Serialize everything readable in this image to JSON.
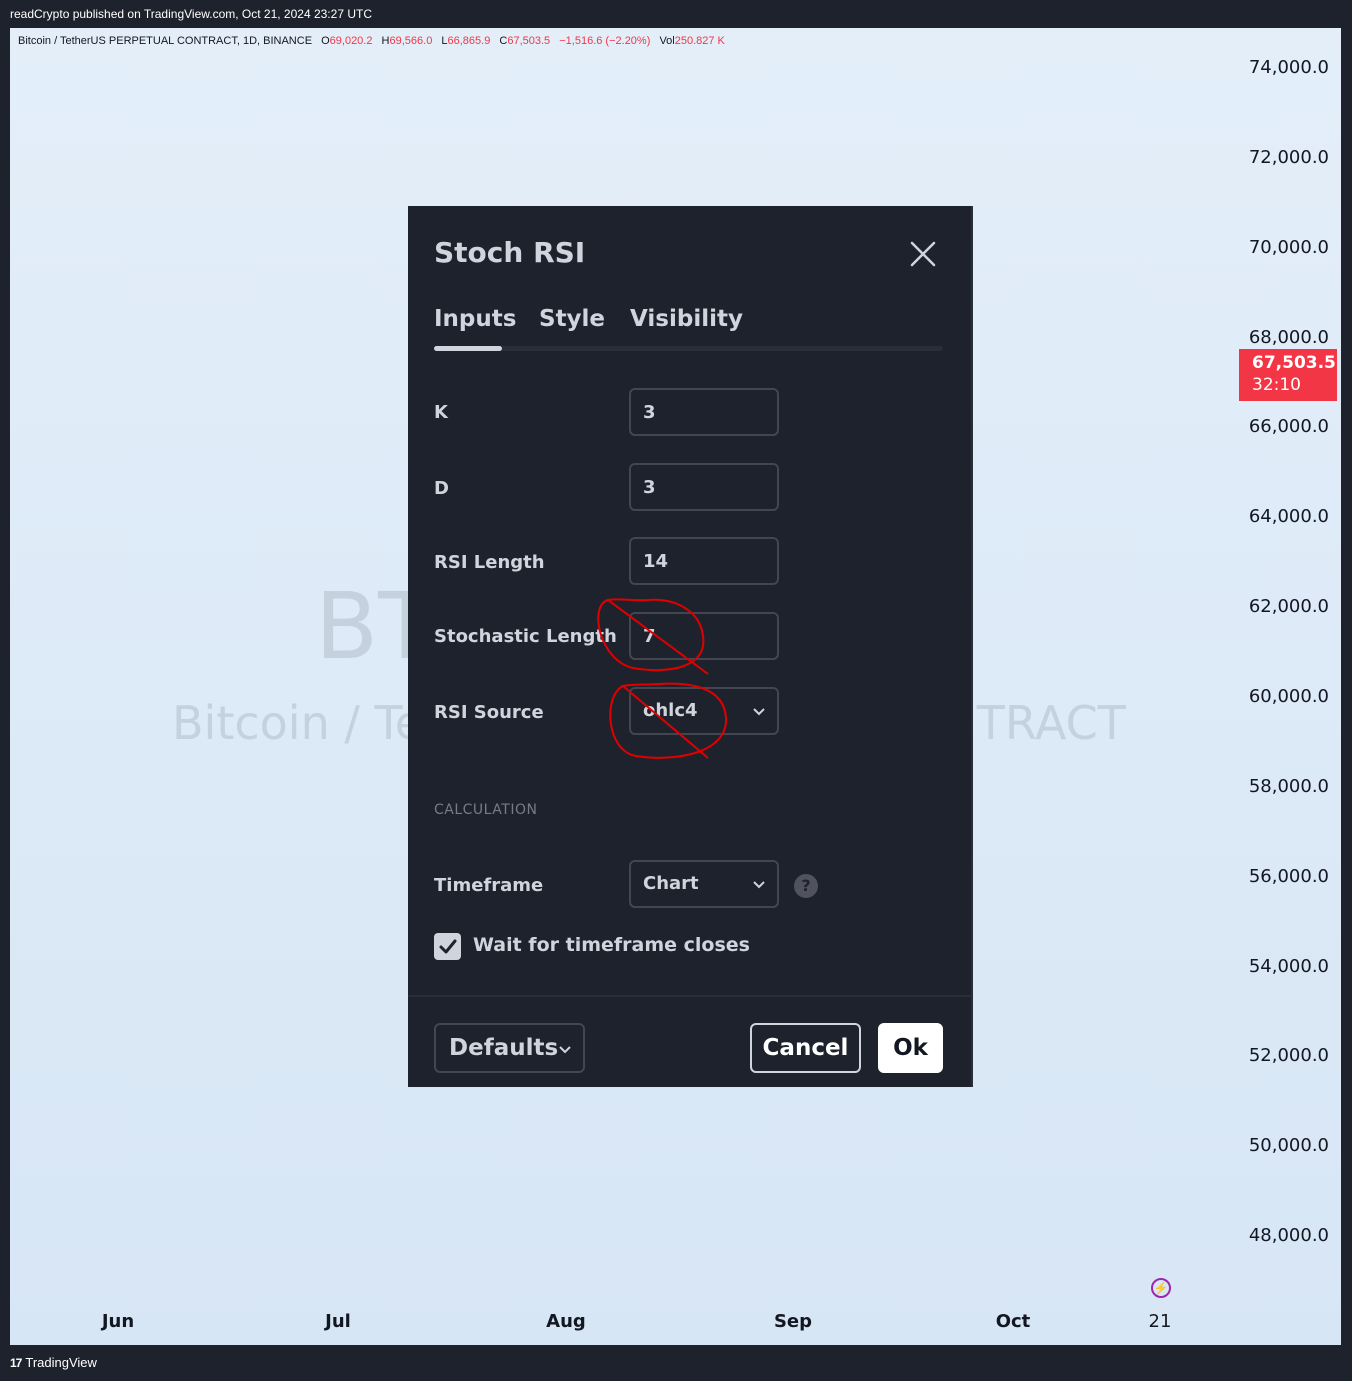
{
  "header": {
    "publish_text": "readCrypto published on TradingView.com, Oct 21, 2024 23:27 UTC"
  },
  "legend": {
    "symbol": "Bitcoin / TetherUS PERPETUAL CONTRACT, 1D, BINANCE",
    "open_label": "O",
    "open_value": "69,020.2",
    "high_label": "H",
    "high_value": "69,566.0",
    "low_label": "L",
    "low_value": "66,865.9",
    "close_label": "C",
    "close_value": "67,503.5",
    "change_value": "−1,516.6 (−2.20%)",
    "vol_label": "Vol",
    "vol_value": "250.827 K",
    "value_color": "#f23645"
  },
  "watermark": {
    "ticker": "BTCUSDT.P",
    "name": "Bitcoin / TetherUS PERPETUAL CONTRACT"
  },
  "price_axis": {
    "labels": [
      "74,000.0",
      "72,000.0",
      "70,000.0",
      "68,000.0",
      "66,000.0",
      "64,000.0",
      "62,000.0",
      "60,000.0",
      "58,000.0",
      "56,000.0",
      "54,000.0",
      "52,000.0",
      "50,000.0",
      "48,000.0"
    ],
    "current_price": "67,503.5",
    "countdown": "32:10",
    "current_price_color": "#f23645"
  },
  "time_axis": {
    "labels": [
      "Jun",
      "Jul",
      "Aug",
      "Sep",
      "Oct",
      "21"
    ]
  },
  "dialog": {
    "title": "Stoch RSI",
    "close_icon": "close-icon",
    "tabs": [
      {
        "label": "Inputs",
        "active": true
      },
      {
        "label": "Style",
        "active": false
      },
      {
        "label": "Visibility",
        "active": false
      }
    ],
    "inputs": {
      "k_label": "K",
      "k_value": "3",
      "d_label": "D",
      "d_value": "3",
      "rsi_length_label": "RSI Length",
      "rsi_length_value": "14",
      "stoch_length_label": "Stochastic Length",
      "stoch_length_value": "7",
      "rsi_source_label": "RSI Source",
      "rsi_source_value": "ohlc4"
    },
    "calculation": {
      "section_label": "CALCULATION",
      "timeframe_label": "Timeframe",
      "timeframe_value": "Chart",
      "help_icon": "question-icon",
      "wait_checkbox_label": "Wait for timeframe closes",
      "wait_checked": true
    },
    "footer": {
      "defaults_label": "Defaults",
      "cancel_label": "Cancel",
      "ok_label": "Ok"
    },
    "annotation_color": "#e00000"
  },
  "footer_brand": {
    "logo_text": "17",
    "brand_name": "TradingView"
  }
}
